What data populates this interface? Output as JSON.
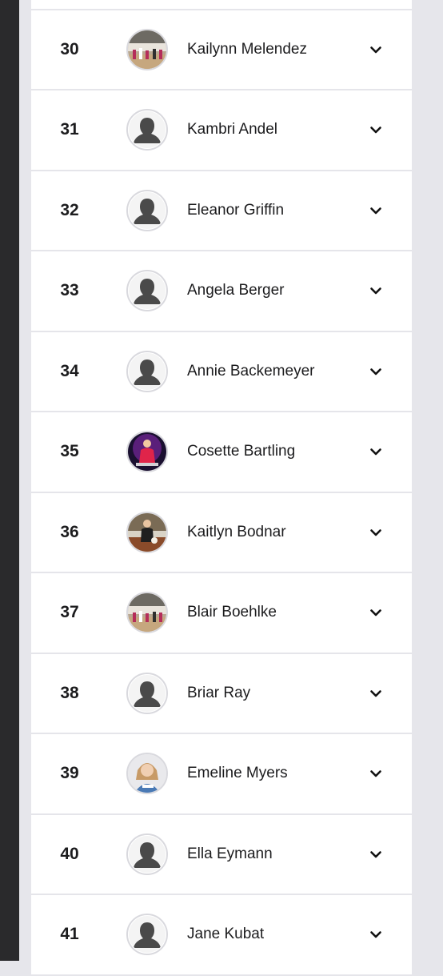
{
  "players": [
    {
      "rank": "",
      "name": "",
      "avatar": "placeholder"
    },
    {
      "rank": "30",
      "name": "Kailynn Melendez",
      "avatar": "photo-gym"
    },
    {
      "rank": "31",
      "name": "Kambri Andel",
      "avatar": "placeholder"
    },
    {
      "rank": "32",
      "name": "Eleanor Griffin",
      "avatar": "placeholder"
    },
    {
      "rank": "33",
      "name": "Angela Berger",
      "avatar": "placeholder"
    },
    {
      "rank": "34",
      "name": "Annie Backemeyer",
      "avatar": "placeholder"
    },
    {
      "rank": "35",
      "name": "Cosette Bartling",
      "avatar": "photo-purple"
    },
    {
      "rank": "36",
      "name": "Kaitlyn Bodnar",
      "avatar": "photo-court"
    },
    {
      "rank": "37",
      "name": "Blair Boehlke",
      "avatar": "photo-gym"
    },
    {
      "rank": "38",
      "name": "Briar Ray",
      "avatar": "placeholder"
    },
    {
      "rank": "39",
      "name": "Emeline Myers",
      "avatar": "photo-portrait"
    },
    {
      "rank": "40",
      "name": "Ella Eymann",
      "avatar": "placeholder"
    },
    {
      "rank": "41",
      "name": "Jane Kubat",
      "avatar": "placeholder"
    }
  ],
  "icons": {
    "expand": "chevron-down-icon",
    "avatar_placeholder": "person-silhouette-icon"
  },
  "colors": {
    "background": "#e6e6eb",
    "row": "#ffffff",
    "divider": "#e5e5ea",
    "text": "#1c1c1e"
  }
}
